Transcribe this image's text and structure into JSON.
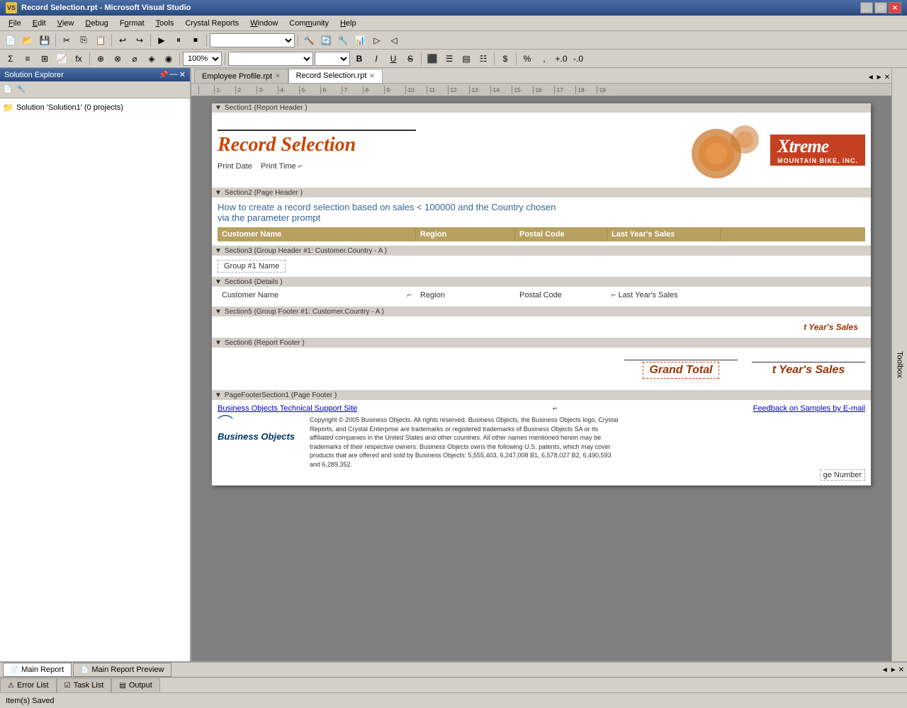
{
  "titlebar": {
    "title": "Record Selection.rpt - Microsoft Visual Studio",
    "icon": "VS",
    "controls": [
      "_",
      "□",
      "✕"
    ]
  },
  "menubar": {
    "items": [
      "File",
      "Edit",
      "View",
      "Debug",
      "Format",
      "Tools",
      "Crystal Reports",
      "Window",
      "Community",
      "Help"
    ]
  },
  "toolbar": {
    "zoom": "100%",
    "fontname": "",
    "fontsize": ""
  },
  "tabs": [
    {
      "label": "Employee Profile.rpt",
      "active": false
    },
    {
      "label": "Record Selection.rpt",
      "active": true
    }
  ],
  "solution_explorer": {
    "title": "Solution Explorer",
    "items": [
      {
        "label": "Solution 'Solution1' (0 projects)"
      }
    ]
  },
  "toolbox": {
    "label": "Toolbox"
  },
  "report": {
    "sections": [
      {
        "id": "section1",
        "label": "Section1 (Report Header )",
        "type": "report-header"
      },
      {
        "id": "section2",
        "label": "Section2 (Page Header )",
        "type": "page-header"
      },
      {
        "id": "section3",
        "label": "Section3 (Group Header #1: Customer.Country - A )",
        "type": "group-header"
      },
      {
        "id": "section4",
        "label": "Section4 (Details )",
        "type": "details"
      },
      {
        "id": "section5",
        "label": "Section5 (Group Footer #1: Customer.Country - A )",
        "type": "group-footer"
      },
      {
        "id": "section6",
        "label": "Section6 (Report Footer )",
        "type": "report-footer"
      },
      {
        "id": "pagefooter",
        "label": "PageFooterSection1 (Page Footer )",
        "type": "page-footer"
      }
    ],
    "header": {
      "title": "Record Selection",
      "print_date_label": "Print Date",
      "print_time_label": "Print Time",
      "logo_text": "Xtreme",
      "logo_sub": "MOUNTAIN BIKE, INC."
    },
    "page_header": {
      "how_to_text": "How to create a record selection based on sales < 100000 and the Country chosen",
      "how_to_text2": "via the parameter prompt",
      "columns": [
        "Customer Name",
        "Region",
        "Postal Code",
        "Last Year's Sales"
      ]
    },
    "group_header": {
      "label": "Group #1 Name"
    },
    "details": {
      "fields": [
        "Customer Name",
        "Region",
        "Postal Code",
        "Last Year's Sales"
      ]
    },
    "group_footer": {
      "value": "t Year's Sales"
    },
    "report_footer": {
      "grand_total_label": "Grand Total",
      "grand_total_value": "t Year's Sales"
    },
    "page_footer": {
      "link1": "Business Objects Technical Support Site",
      "link2": "Feedback on Samples by E-mail",
      "bo_logo": "Business Objects",
      "copyright": "Copyright © 2005 Business Objects. All rights reserved. Business Objects, the Business Objects logo, Crystal Reports, and Crystal Enterprise are trademarks or registered trademarks of Business Objects SA or its affiliated companies in the United States and other countries.  All other names mentioned herein may be trademarks of their respective owners. Business Objects owns the following U.S. patents, which may cover products that are offered and sold by Business Objects: 5,555,403, 6,247,008 B1, 6,578,027 B2, 6,490,593 and 6,289,352.",
      "page_number": "ge Number"
    }
  },
  "bottom_tabs": [
    {
      "label": "Error List",
      "active": false,
      "icon": "⚠"
    },
    {
      "label": "Task List",
      "active": false,
      "icon": "☑"
    },
    {
      "label": "Output",
      "active": false,
      "icon": "▤"
    }
  ],
  "report_tabs": [
    {
      "label": "Main Report",
      "active": true,
      "icon": "📄"
    },
    {
      "label": "Main Report Preview",
      "active": false,
      "icon": "📄"
    }
  ],
  "status_bar": {
    "text": "Item(s) Saved"
  },
  "nav_controls": [
    "◄",
    "►",
    "✕"
  ]
}
